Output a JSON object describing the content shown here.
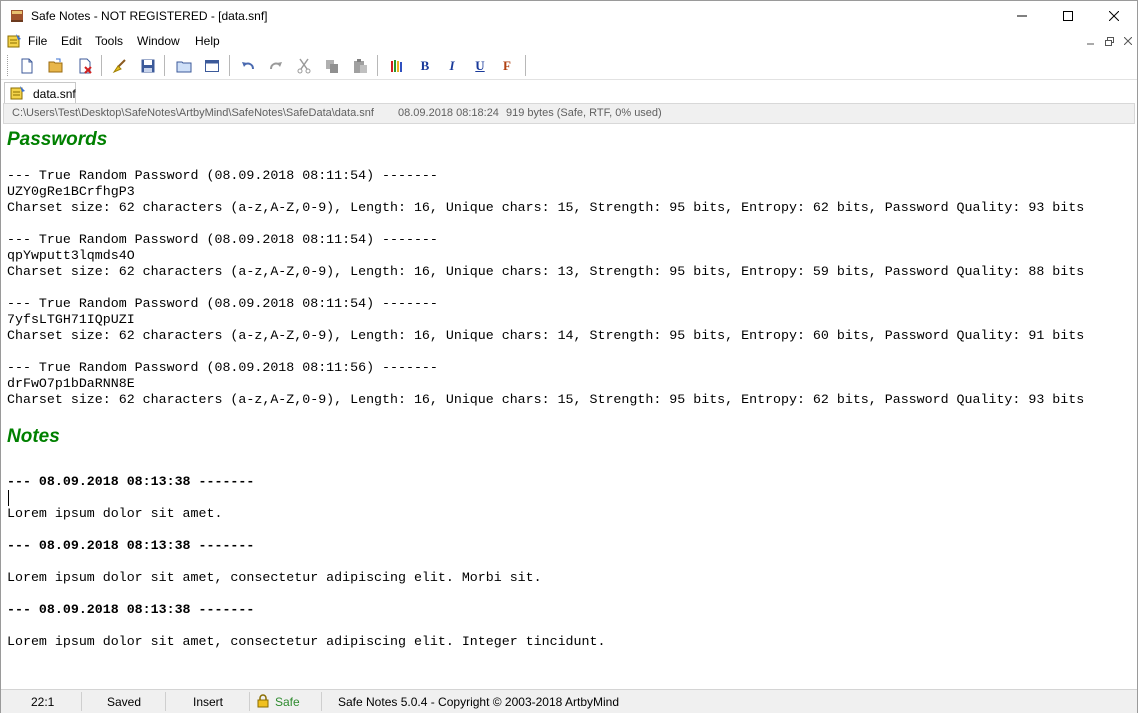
{
  "window": {
    "title": "Safe Notes - NOT REGISTERED - [data.snf]"
  },
  "menu": {
    "items": [
      "File",
      "Edit",
      "Tools",
      "Window",
      "Help"
    ]
  },
  "toolbar": {
    "bold": "B",
    "italic": "I",
    "underline": "U",
    "font": "F"
  },
  "tabs": [
    {
      "label": "data.snf"
    }
  ],
  "pathbar": {
    "path": "C:\\Users\\Test\\Desktop\\SafeNotes\\ArtbyMind\\SafeNotes\\SafeData\\data.snf",
    "datetime": "08.09.2018 08:18:24",
    "info": "919 bytes (Safe, RTF, 0% used)"
  },
  "document": {
    "passwords_heading": "Passwords",
    "passwords": [
      {
        "header": "--- True Random Password (08.09.2018 08:11:54) -------",
        "password": "UZY0gRe1BCrfhgP3",
        "details": "Charset size: 62 characters (a-z,A-Z,0-9), Length: 16, Unique chars: 15, Strength: 95 bits, Entropy: 62 bits, Password Quality: 93 bits"
      },
      {
        "header": "--- True Random Password (08.09.2018 08:11:54) -------",
        "password": "qpYwputt3lqmds4O",
        "details": "Charset size: 62 characters (a-z,A-Z,0-9), Length: 16, Unique chars: 13, Strength: 95 bits, Entropy: 59 bits, Password Quality: 88 bits"
      },
      {
        "header": "--- True Random Password (08.09.2018 08:11:54) -------",
        "password": "7yfsLTGH71IQpUZI",
        "details": "Charset size: 62 characters (a-z,A-Z,0-9), Length: 16, Unique chars: 14, Strength: 95 bits, Entropy: 60 bits, Password Quality: 91 bits"
      },
      {
        "header": "--- True Random Password (08.09.2018 08:11:56) -------",
        "password": "drFwO7p1bDaRNN8E",
        "details": "Charset size: 62 characters (a-z,A-Z,0-9), Length: 16, Unique chars: 15, Strength: 95 bits, Entropy: 62 bits, Password Quality: 93 bits"
      }
    ],
    "notes_heading": "Notes",
    "notes": [
      {
        "header": "--- 08.09.2018 08:13:38 -------",
        "text": "Lorem ipsum dolor sit amet."
      },
      {
        "header": "--- 08.09.2018 08:13:38 -------",
        "text": "Lorem ipsum dolor sit amet, consectetur adipiscing elit. Morbi sit."
      },
      {
        "header": "--- 08.09.2018 08:13:38 -------",
        "text": "Lorem ipsum dolor sit amet, consectetur adipiscing elit. Integer tincidunt."
      }
    ]
  },
  "status": {
    "position": "22:1",
    "saved": "Saved",
    "mode": "Insert",
    "safe": "Safe",
    "copyright": "Safe Notes 5.0.4  -  Copyright © 2003-2018 ArtbyMind"
  },
  "colors": {
    "heading": "#008000",
    "safe": "#2e8b2e"
  }
}
